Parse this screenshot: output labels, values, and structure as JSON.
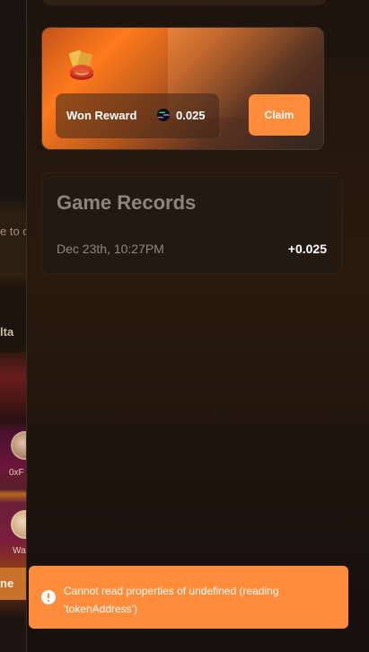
{
  "left_page": {
    "banner_text": "e to o",
    "tab_text": "lta",
    "player_1": "0xF",
    "player_2": "Wa",
    "button_text": "ne"
  },
  "reward": {
    "label": "Won Reward",
    "amount": "0.025",
    "claim_label": "Claim",
    "icons": [
      "poker-chip-icon",
      "sol-token-icon"
    ]
  },
  "records": {
    "title": "Game Records",
    "entries": [
      {
        "time": "Dec 23th, 10:27PM",
        "amount": "+0.025"
      }
    ]
  },
  "toast": {
    "message": "Cannot read properties of undefined (reading 'tokenAddress')",
    "icon": "error-icon"
  },
  "colors": {
    "accent": "#ff8c3a",
    "panel": "#241910",
    "muted_text": "#8d8680"
  }
}
